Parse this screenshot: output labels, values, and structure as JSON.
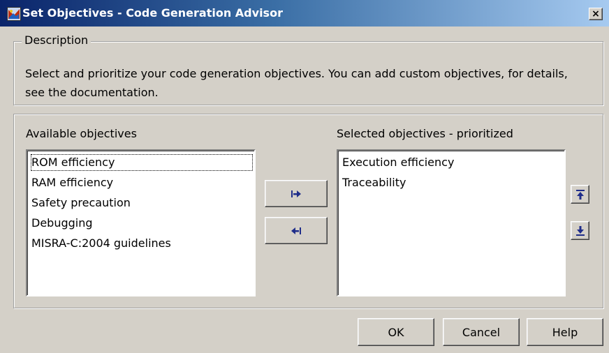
{
  "window": {
    "title": "Set Objectives - Code Generation Advisor",
    "close_glyph": "×"
  },
  "description": {
    "legend": "Description",
    "text": "Select and prioritize your code generation objectives. You can add custom objectives, for details, see the documentation."
  },
  "available": {
    "label": "Available objectives",
    "items": [
      "ROM efficiency",
      "RAM efficiency",
      "Safety precaution",
      "Debugging",
      "MISRA-C:2004 guidelines"
    ],
    "focused_index": 0
  },
  "selected": {
    "label": "Selected objectives - prioritized",
    "items": [
      "Execution efficiency",
      "Traceability"
    ]
  },
  "icons": {
    "add": "arrow-right-icon",
    "remove": "arrow-left-icon",
    "move_up": "move-up-icon",
    "move_down": "move-down-icon",
    "app": "app-icon"
  },
  "colors": {
    "icon_blue": "#1f2d8a",
    "dialog_bg": "#d4d0c8"
  },
  "buttons": {
    "ok": "OK",
    "cancel": "Cancel",
    "help": "Help"
  }
}
